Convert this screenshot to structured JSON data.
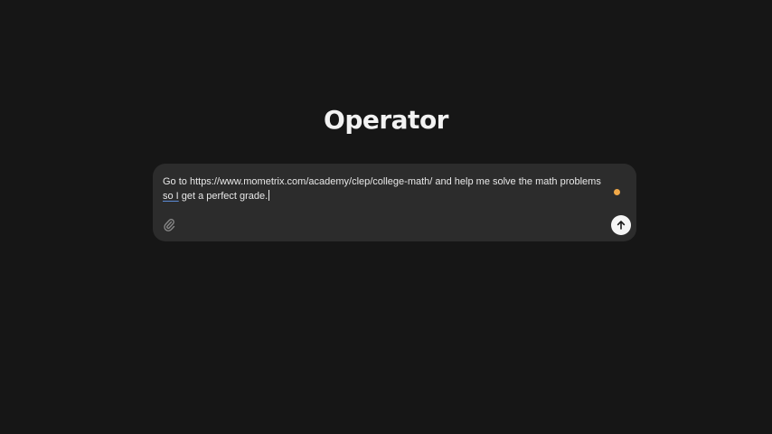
{
  "app": {
    "title": "Operator"
  },
  "composer": {
    "prompt_line1": "Go to https://www.mometrix.com/academy/clep/college-math/ and help me solve the math problems",
    "prompt_spell_word": "so I",
    "prompt_rest": " get a perfect grade.",
    "attach_icon": "paperclip-icon",
    "send_icon": "arrow-up-icon",
    "status_color": "#f0a848"
  }
}
